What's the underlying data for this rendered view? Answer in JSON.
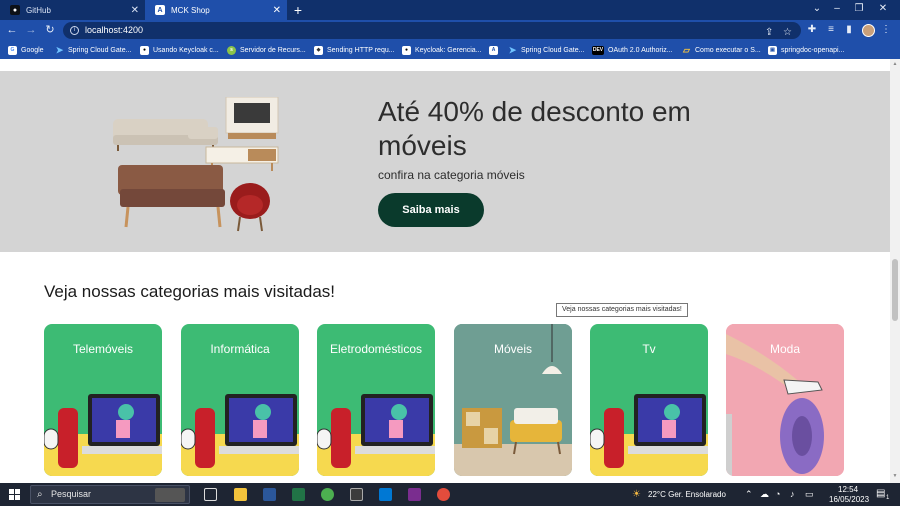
{
  "browser": {
    "tabs": [
      {
        "title": "GitHub",
        "active": false
      },
      {
        "title": "MCK Shop",
        "active": true
      }
    ],
    "new_tab": "+",
    "address": "localhost:4200",
    "bookmarks": [
      {
        "label": "Google",
        "icon": "google-icon"
      },
      {
        "label": "Spring Cloud Gate...",
        "icon": "arrow-bookmark-icon"
      },
      {
        "label": "Usando Keycloak c...",
        "icon": "keycloak-icon"
      },
      {
        "label": "Servidor de Recurs...",
        "icon": "server-icon"
      },
      {
        "label": "Sending HTTP requ...",
        "icon": "http-icon"
      },
      {
        "label": "Keycloak: Gerencia...",
        "icon": "keycloak-icon"
      },
      {
        "label": "",
        "icon": "angular-icon"
      },
      {
        "label": "Spring Cloud Gate...",
        "icon": "arrow-bookmark-icon"
      },
      {
        "label": "OAuth 2.0 Authoriz...",
        "icon": "dev-icon"
      },
      {
        "label": "Como executar o S...",
        "icon": "folder-icon"
      },
      {
        "label": "springdoc-openapi...",
        "icon": "springdoc-icon"
      }
    ]
  },
  "hero": {
    "title": "Até 40% de desconto em móveis",
    "subtitle": "confira na categoria móveis",
    "button": "Saiba mais"
  },
  "categories": {
    "title": "Veja nossas categorias mais visitadas!",
    "tooltip": "Veja  nossas categorias mais visitadas!",
    "items": [
      {
        "label": "Telemóveis",
        "image": "electronics"
      },
      {
        "label": "Informática",
        "image": "electronics"
      },
      {
        "label": "Eletrodomésticos",
        "image": "electronics"
      },
      {
        "label": "Móveis",
        "image": "living-room"
      },
      {
        "label": "Tv",
        "image": "electronics"
      },
      {
        "label": "Moda",
        "image": "fashion"
      }
    ]
  },
  "taskbar": {
    "search_placeholder": "Pesquisar",
    "weather": "22°C  Ger. Ensolarado",
    "time": "12:54",
    "date": "16/05/2023",
    "notification_count": "1"
  },
  "colors": {
    "tab_bar": "#10306b",
    "toolbar": "#1f4faa",
    "hero_bg": "#d4d4d4",
    "button": "#0a3a2c",
    "card_green": "#3dbb74",
    "card_pink": "#f2a7b2"
  }
}
